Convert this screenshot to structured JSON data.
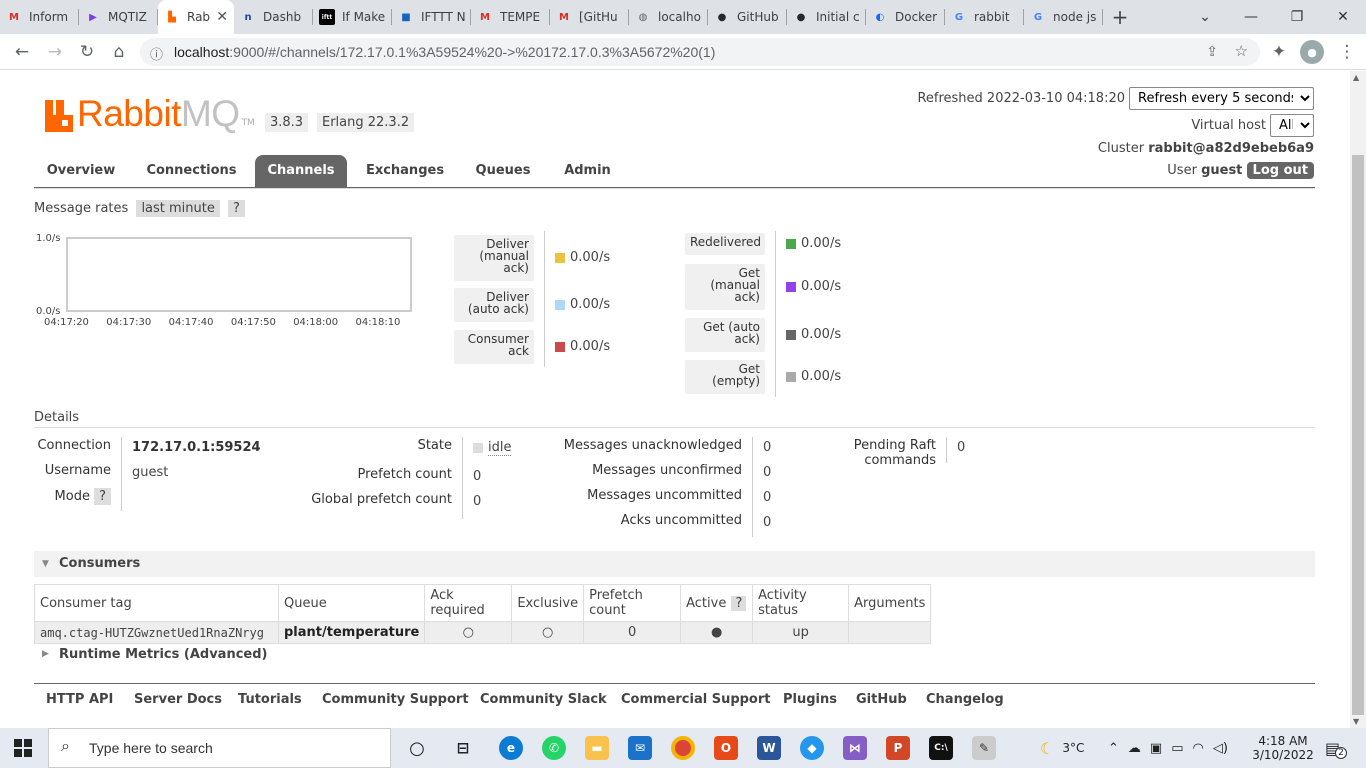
{
  "browser": {
    "tabs": [
      {
        "label": "Inform",
        "icon": "gmail-icon",
        "color": "#d93025",
        "glyph": "M"
      },
      {
        "label": "MQTIZ",
        "icon": "play-icon",
        "color": "#7b3fe4",
        "glyph": "▶"
      },
      {
        "label": "Rab",
        "icon": "rabbitmq-icon",
        "color": "#f60",
        "glyph": "▙",
        "active": true
      },
      {
        "label": "Dashb",
        "icon": "dashboard-icon",
        "color": "#1e4a9e",
        "glyph": "n"
      },
      {
        "label": "If Make",
        "icon": "ifttt-icon",
        "color": "#000",
        "glyph": "iftt"
      },
      {
        "label": "IFTTT N",
        "icon": "ifttt-blue-icon",
        "color": "#1565c0",
        "glyph": "■"
      },
      {
        "label": "TEMPE",
        "icon": "gmail-icon",
        "color": "#d93025",
        "glyph": "M"
      },
      {
        "label": "[GitHu",
        "icon": "gmail-icon",
        "color": "#d93025",
        "glyph": "M"
      },
      {
        "label": "localho",
        "icon": "globe-icon",
        "color": "#5f6368",
        "glyph": "◍"
      },
      {
        "label": "GitHub",
        "icon": "github-icon",
        "color": "#24292e",
        "glyph": "●"
      },
      {
        "label": "Initial c",
        "icon": "github-icon",
        "color": "#24292e",
        "glyph": "●"
      },
      {
        "label": "Docker",
        "icon": "docker-icon",
        "color": "#1d63ed",
        "glyph": "◐"
      },
      {
        "label": "rabbit",
        "icon": "google-icon",
        "color": "#4285f4",
        "glyph": "G"
      },
      {
        "label": "node js",
        "icon": "google-icon",
        "color": "#4285f4",
        "glyph": "G"
      }
    ],
    "url_host": "localhost",
    "url_rest": ":9000/#/channels/172.17.0.1%3A59524%20->%20172.17.0.3%3A5672%20(1)"
  },
  "header": {
    "logo_rabbit": "Rabbit",
    "logo_mq": "MQ",
    "logo_tm": "TM",
    "version": "3.8.3",
    "erlang": "Erlang 22.3.2",
    "refreshed_label": "Refreshed 2022-03-10 04:18:20",
    "refresh_select": "Refresh every 5 seconds",
    "vhost_label": "Virtual host",
    "vhost_select": "All",
    "cluster_label": "Cluster",
    "cluster_name": "rabbit@a82d9ebeb6a9",
    "user_label": "User",
    "user_name": "guest",
    "logout": "Log out"
  },
  "nav": [
    "Overview",
    "Connections",
    "Channels",
    "Exchanges",
    "Queues",
    "Admin"
  ],
  "rates": {
    "label": "Message rates",
    "period": "last minute",
    "help": "?",
    "y_max": "1.0/s",
    "y_min": "0.0/s",
    "x_ticks": [
      "04:17:20",
      "04:17:30",
      "04:17:40",
      "04:17:50",
      "04:18:00",
      "04:18:10"
    ],
    "legend_left": [
      {
        "label": "Deliver (manual ack)",
        "l1": "Deliver",
        "l2": "(manual",
        "l3": "ack)",
        "value": "0.00/s",
        "color": "#edc240"
      },
      {
        "label": "Deliver (auto ack)",
        "l1": "Deliver",
        "l2": "(auto ack)",
        "value": "0.00/s",
        "color": "#afd8f8"
      },
      {
        "label": "Consumer ack",
        "l1": "Consumer",
        "l2": "ack",
        "value": "0.00/s",
        "color": "#cb4b4b"
      }
    ],
    "legend_right": [
      {
        "label": "Redelivered",
        "l1": "Redelivered",
        "value": "0.00/s",
        "color": "#4da74d"
      },
      {
        "label": "Get (manual ack)",
        "l1": "Get",
        "l2": "(manual",
        "l3": "ack)",
        "value": "0.00/s",
        "color": "#9440ed"
      },
      {
        "label": "Get (auto ack)",
        "l1": "Get (auto",
        "l2": "ack)",
        "value": "0.00/s",
        "color": "#666666"
      },
      {
        "label": "Get (empty)",
        "l1": "Get",
        "l2": "(empty)",
        "value": "0.00/s",
        "color": "#aaaaaa"
      }
    ]
  },
  "details": {
    "heading": "Details",
    "connection_label": "Connection",
    "connection": "172.17.0.1:59524",
    "username_label": "Username",
    "username": "guest",
    "mode_label": "Mode",
    "mode_help": "?",
    "state_label": "State",
    "state": "idle",
    "prefetch_label": "Prefetch count",
    "prefetch": "0",
    "global_prefetch_label": "Global prefetch count",
    "global_prefetch": "0",
    "unacked_label": "Messages unacknowledged",
    "unacked": "0",
    "unconfirmed_label": "Messages unconfirmed",
    "unconfirmed": "0",
    "uncommitted_label": "Messages uncommitted",
    "uncommitted": "0",
    "acks_uncommitted_label": "Acks uncommitted",
    "acks_uncommitted": "0",
    "raft_label": "Pending Raft commands",
    "raft": "0"
  },
  "consumers": {
    "heading": "Consumers",
    "columns": [
      "Consumer tag",
      "Queue",
      "Ack required",
      "Exclusive",
      "Prefetch count",
      "Active",
      "Activity status",
      "Arguments"
    ],
    "active_help": "?",
    "rows": [
      {
        "tag": "amq.ctag-HUTZGwznetUed1RnaZNryg",
        "queue": "plant/temperature",
        "ack": "○",
        "exclusive": "○",
        "prefetch": "0",
        "active": "●",
        "status": "up",
        "args": ""
      }
    ]
  },
  "runtime": "Runtime Metrics (Advanced)",
  "footer": [
    "HTTP API",
    "Server Docs",
    "Tutorials",
    "Community Support",
    "Community Slack",
    "Commercial Support",
    "Plugins",
    "GitHub",
    "Changelog"
  ],
  "taskbar": {
    "search_placeholder": "Type here to search",
    "weather": "3°C",
    "time": "4:18 AM",
    "date": "3/10/2022",
    "notifications": "2"
  }
}
